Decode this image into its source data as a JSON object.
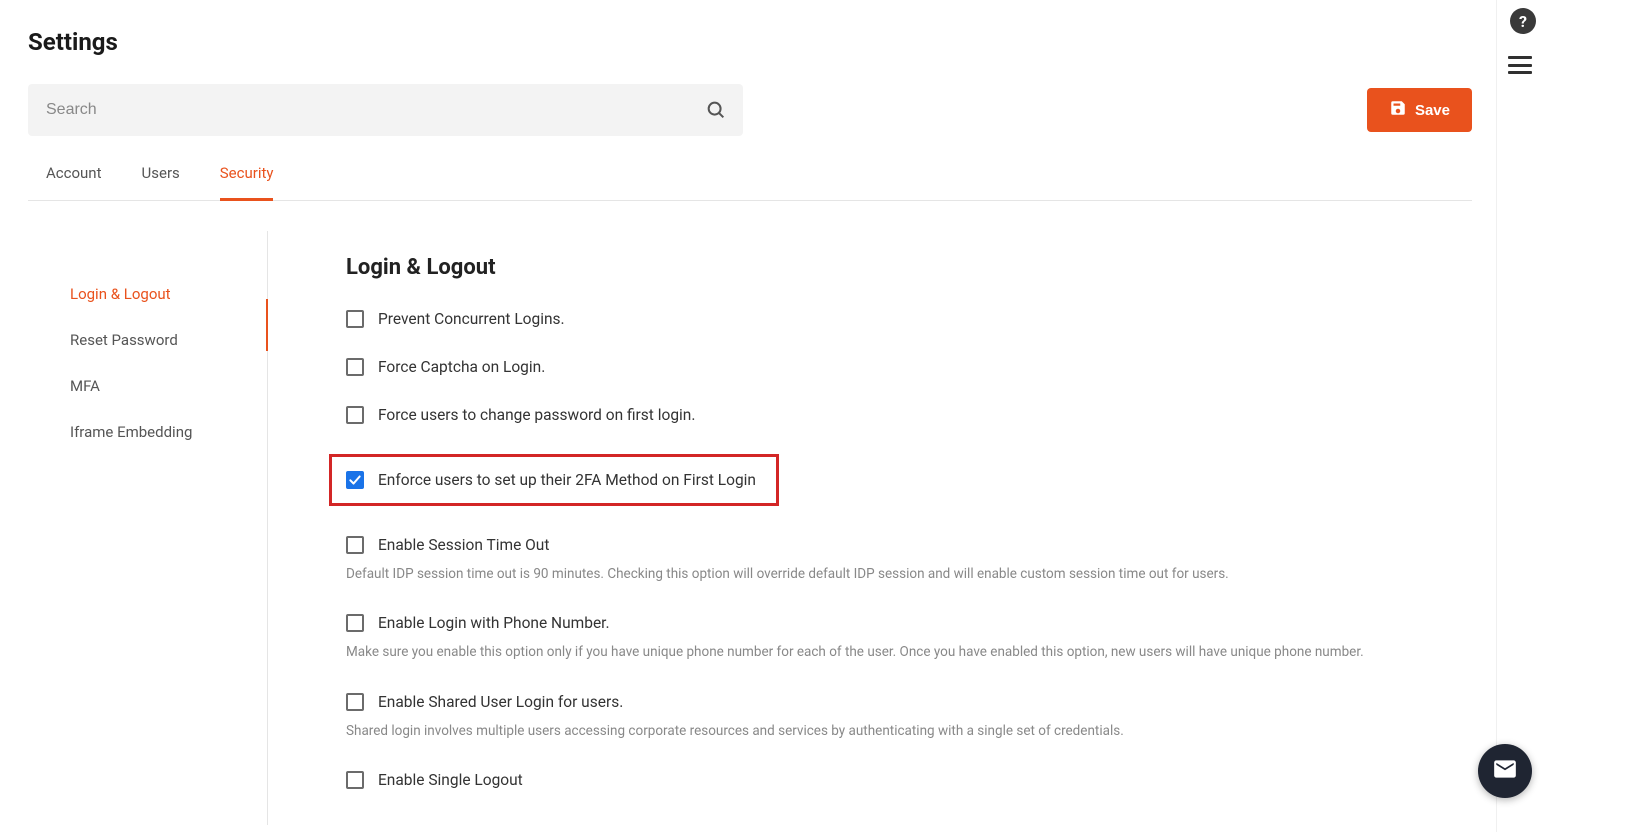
{
  "page": {
    "title": "Settings"
  },
  "search": {
    "placeholder": "Search"
  },
  "actions": {
    "save": "Save"
  },
  "tabs": [
    {
      "label": "Account",
      "active": false
    },
    {
      "label": "Users",
      "active": false
    },
    {
      "label": "Security",
      "active": true
    }
  ],
  "sidenav": [
    {
      "label": "Login & Logout",
      "active": true
    },
    {
      "label": "Reset Password",
      "active": false
    },
    {
      "label": "MFA",
      "active": false
    },
    {
      "label": "Iframe Embedding",
      "active": false
    }
  ],
  "panel": {
    "title": "Login & Logout",
    "options": [
      {
        "label": "Prevent Concurrent Logins.",
        "checked": false,
        "highlighted": false,
        "description": ""
      },
      {
        "label": "Force Captcha on Login.",
        "checked": false,
        "highlighted": false,
        "description": ""
      },
      {
        "label": "Force users to change password on first login.",
        "checked": false,
        "highlighted": false,
        "description": ""
      },
      {
        "label": "Enforce users to set up their 2FA Method on First Login",
        "checked": true,
        "highlighted": true,
        "description": ""
      },
      {
        "label": "Enable Session Time Out",
        "checked": false,
        "highlighted": false,
        "description": "Default IDP session time out is 90 minutes. Checking this option will override default IDP session and will enable custom session time out for users."
      },
      {
        "label": "Enable Login with Phone Number.",
        "checked": false,
        "highlighted": false,
        "description": "Make sure you enable this option only if you have unique phone number for each of the user. Once you have enabled this option, new users will have unique phone number."
      },
      {
        "label": "Enable Shared User Login for users.",
        "checked": false,
        "highlighted": false,
        "description": "Shared login involves multiple users accessing corporate resources and services by authenticating with a single set of credentials."
      },
      {
        "label": "Enable Single Logout",
        "checked": false,
        "highlighted": false,
        "description": ""
      }
    ]
  },
  "help": {
    "symbol": "?"
  }
}
